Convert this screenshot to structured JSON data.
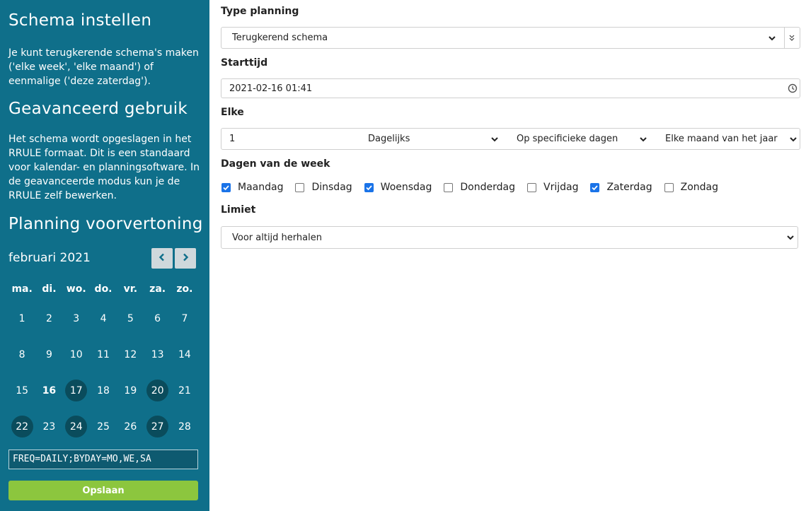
{
  "sidebar": {
    "title": "Schema instellen",
    "intro": "Je kunt terugkerende schema's maken ('elke week', 'elke maand') of eenmalige ('deze zaterdag').",
    "advanced_title": "Geavanceerd gebruik",
    "advanced_text": "Het schema wordt opgeslagen in het RRULE formaat. Dit is een standaard voor kalendar- en planningsoftware. In de geavanceerde modus kun je de RRULE zelf bewerken.",
    "preview_title": "Planning voorvertoning",
    "calendar": {
      "month": "februari 2021",
      "weekdays": [
        "ma.",
        "di.",
        "wo.",
        "do.",
        "vr.",
        "za.",
        "zo."
      ],
      "days": [
        "1",
        "2",
        "3",
        "4",
        "5",
        "6",
        "7",
        "8",
        "9",
        "10",
        "11",
        "12",
        "13",
        "14",
        "15",
        "16",
        "17",
        "18",
        "19",
        "20",
        "21",
        "22",
        "23",
        "24",
        "25",
        "26",
        "27",
        "28"
      ],
      "today": "16",
      "highlighted": [
        "17",
        "20",
        "22",
        "24",
        "27"
      ]
    },
    "rrule": "FREQ=DAILY;BYDAY=MO,WE,SA",
    "save_label": "Opslaan"
  },
  "form": {
    "type_label": "Type planning",
    "type_value": "Terugkerend schema",
    "start_label": "Starttijd",
    "start_value": "2021-02-16 01:41",
    "every_label": "Elke",
    "every_interval": "1",
    "every_freq": "Dagelijks",
    "every_days": "Op specificieke dagen",
    "every_months": "Elke maand van het jaar",
    "weekdays_label": "Dagen van de week",
    "weekdays": [
      {
        "label": "Maandag",
        "checked": true
      },
      {
        "label": "Dinsdag",
        "checked": false
      },
      {
        "label": "Woensdag",
        "checked": true
      },
      {
        "label": "Donderdag",
        "checked": false
      },
      {
        "label": "Vrijdag",
        "checked": false
      },
      {
        "label": "Zaterdag",
        "checked": true
      },
      {
        "label": "Zondag",
        "checked": false
      }
    ],
    "limit_label": "Limiet",
    "limit_value": "Voor altijd herhalen"
  },
  "colors": {
    "sidebar_bg": "#0f6f8a",
    "highlight_day": "#0a4c5c",
    "save_button": "#8cc63e",
    "checkbox_checked": "#1a73e8"
  }
}
